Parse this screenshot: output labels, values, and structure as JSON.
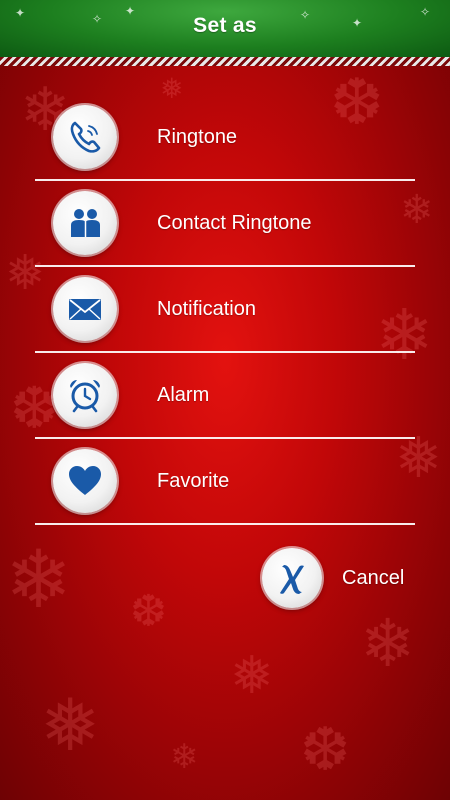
{
  "header": {
    "title": "Set as"
  },
  "menu": {
    "items": [
      {
        "label": "Ringtone",
        "icon": "phone-icon"
      },
      {
        "label": "Contact Ringtone",
        "icon": "contacts-icon"
      },
      {
        "label": "Notification",
        "icon": "envelope-icon"
      },
      {
        "label": "Alarm",
        "icon": "alarm-clock-icon"
      },
      {
        "label": "Favorite",
        "icon": "heart-icon"
      }
    ]
  },
  "cancel": {
    "label": "Cancel",
    "icon": "x-icon"
  },
  "colors": {
    "background": "#c10708",
    "header": "#1d7f1f",
    "icon_blue": "#1a5aa8",
    "text": "#ffffff"
  }
}
